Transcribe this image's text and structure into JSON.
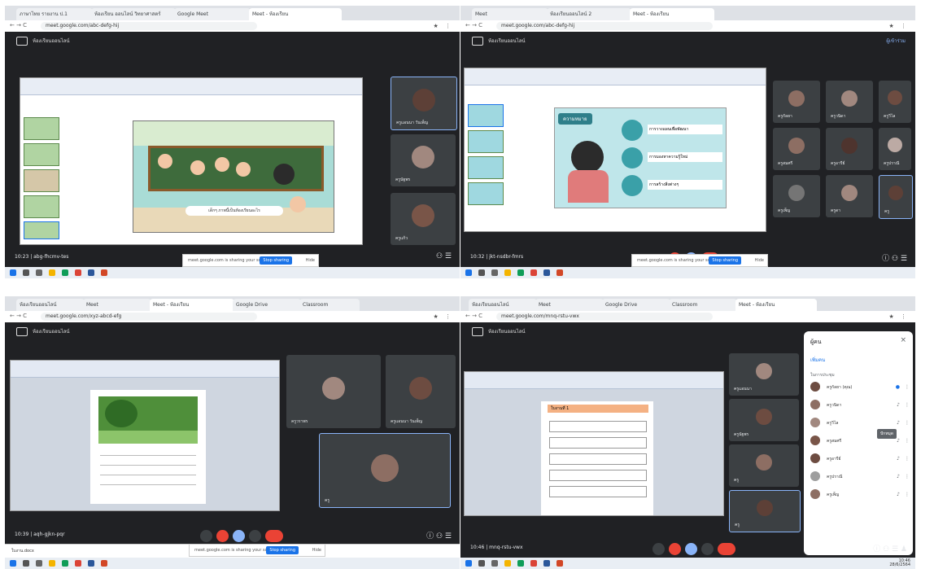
{
  "q1": {
    "tabs": [
      "ภาษาไทย รายงาน ป.1",
      "ห้องเรียน ออนไลน์ วิทยาศาสตร์",
      "Google Meet",
      "Meet - ห้องเรียน"
    ],
    "url": "meet.google.com/abc-defg-hij",
    "meeting_title": "ห้องเรียนออนไลน์",
    "ppt_caption": "เด็กๆ ภาพนี้เป็นห้องเรียนอะไร",
    "participants": [
      {
        "name": "ครูแอนนา วันเพ็ญ",
        "highlight": true
      },
      {
        "name": "ครูนัฐพร"
      },
      {
        "name": "ครูแก้ว"
      }
    ],
    "time_label": "10:23 | abg-fhcmv-tes",
    "banner_text": "meet.google.com is sharing your screen.",
    "banner_button": "Stop sharing",
    "banner_hide": "Hide"
  },
  "q2": {
    "tabs": [
      "Meet",
      "ห้องเรียนออนไลน์ 2",
      "Meet - ห้องเรียน"
    ],
    "url": "meet.google.com/abc-defg-hij",
    "meeting_title": "ห้องเรียนออนไลน์",
    "top_right": "ผู้เข้าร่วม",
    "slide_title": "ความหมาย",
    "slide_bullets": [
      "การวางแผนเพื่อพัฒนา",
      "การมองหาความรู้ใหม่",
      "การสร้างสิ่งต่างๆ"
    ],
    "participants": [
      {
        "name": "ครูกัลยา"
      },
      {
        "name": "ครูวนิดา"
      },
      {
        "name": "ครูวิไล"
      },
      {
        "name": "ครูสมศรี"
      },
      {
        "name": "ครูอารีย์"
      },
      {
        "name": "ครูปราณี"
      },
      {
        "name": "ครูเพ็ญ"
      },
      {
        "name": "ครูดา"
      },
      {
        "name": "ครู"
      }
    ],
    "time_label": "10:32 | jkt-nsdbr-fmrs",
    "banner_text": "meet.google.com is sharing your screen.",
    "banner_button": "Stop sharing",
    "banner_hide": "Hide"
  },
  "q3": {
    "tabs": [
      "ห้องเรียนออนไลน์",
      "Meet",
      "Meet - ห้องเรียน",
      "Google Drive",
      "Classroom"
    ],
    "url": "meet.google.com/xyz-abcd-efg",
    "meeting_title": "ห้องเรียนออนไลน์",
    "participants": [
      {
        "name": "ครูวราพร"
      },
      {
        "name": "ครูแอนนา วันเพ็ญ"
      },
      {
        "name": "ครู",
        "highlight": true
      }
    ],
    "time_label": "10:39 | aqh-gjkn-pqr",
    "download_bar": "ใบงาน.docx",
    "banner_text": "meet.google.com is sharing your screen.",
    "banner_button": "Stop sharing",
    "banner_hide": "Hide"
  },
  "q4": {
    "tabs": [
      "ห้องเรียนออนไลน์",
      "Meet",
      "Google Drive",
      "Classroom",
      "Meet - ห้องเรียน"
    ],
    "url": "meet.google.com/mnq-rstu-vwx",
    "meeting_title": "ห้องเรียนออนไลน์",
    "doc_heading": "ใบงานที่ 1",
    "participants": [
      {
        "name": "ครูแอนนา"
      },
      {
        "name": "ครูนัฐพร"
      },
      {
        "name": "ครู"
      },
      {
        "name": "ครู",
        "highlight": true
      }
    ],
    "panel_title": "ผู้คน",
    "panel_add": "เพิ่มคน",
    "panel_section": "ในการประชุม",
    "panel_people": [
      "ครูกัลยา (คุณ)",
      "ครูวนิดา",
      "ครูวิไล",
      "ครูสมศรี",
      "ครูอารีย์",
      "ครูปราณี",
      "ครูเพ็ญ"
    ],
    "panel_tooltip": "ปักหมุด",
    "time_label": "10:46 | mnq-rstu-vwx"
  },
  "taskbar_time": "10:46",
  "taskbar_date": "28/6/2564"
}
